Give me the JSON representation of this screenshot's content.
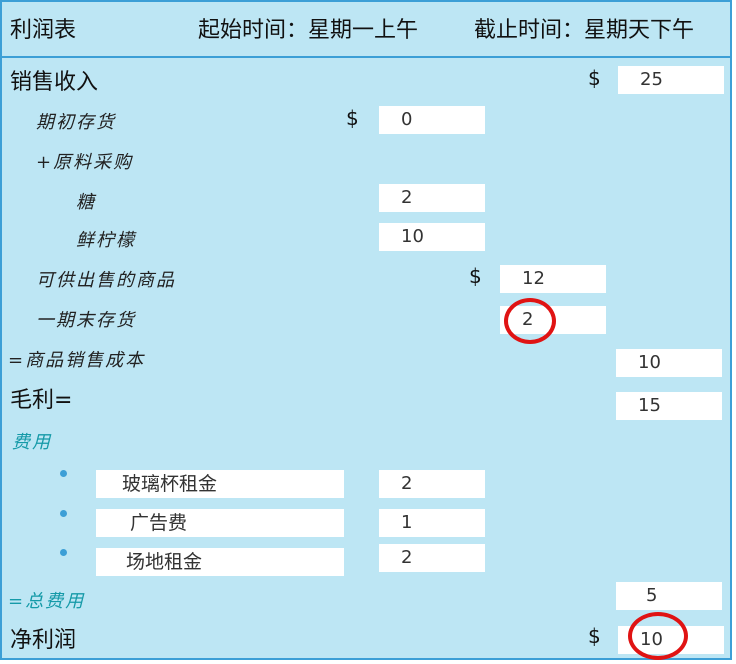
{
  "header": {
    "title": "利润表",
    "start": "起始时间：星期一上午",
    "end": "截止时间：星期天下午"
  },
  "revenue": {
    "label": "销售收入",
    "currency": "$",
    "value": "25"
  },
  "beginning_inventory": {
    "label": "期初存货",
    "currency": "$",
    "value": "0"
  },
  "purchases": {
    "label": "+原料采购"
  },
  "sugar": {
    "label": "糖",
    "value": "2"
  },
  "lemon": {
    "label": "鲜柠檬",
    "value": "10"
  },
  "available": {
    "label": "可供出售的商品",
    "currency": "$",
    "value": "12"
  },
  "ending_inventory": {
    "label": "一期末存货",
    "value": "2"
  },
  "cogs": {
    "label": "=商品销售成本",
    "value": "10"
  },
  "gross_profit": {
    "label": "毛利=",
    "value": "15"
  },
  "expenses": {
    "label": "费用",
    "items": [
      {
        "label": "玻璃杯租金",
        "value": "2"
      },
      {
        "label": "广告费",
        "value": "1"
      },
      {
        "label": "场地租金",
        "value": "2"
      }
    ]
  },
  "total_expenses": {
    "label": "=总费用",
    "value": "5"
  },
  "net_profit": {
    "label": "净利润",
    "currency": "$",
    "value": "10"
  },
  "colors": {
    "background": "#bde6f4",
    "border": "#3c9fd6",
    "highlight": "#e01313",
    "teal": "#159aa8"
  }
}
